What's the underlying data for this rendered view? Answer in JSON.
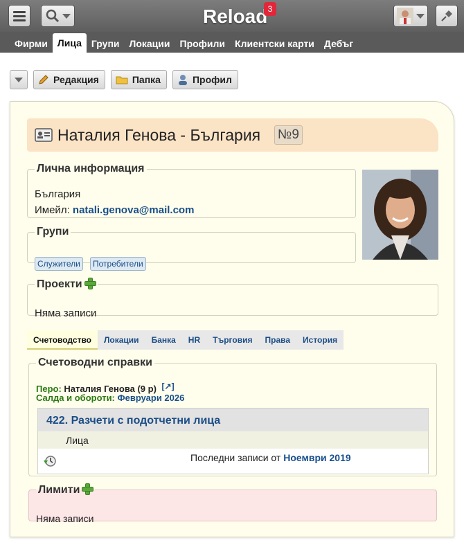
{
  "header": {
    "title": "Reload",
    "badge": "3"
  },
  "nav": {
    "tabs": [
      "Фирми",
      "Лица",
      "Групи",
      "Локации",
      "Профили",
      "Клиентски карти",
      "Дебъг"
    ]
  },
  "toolbar": {
    "edit": "Редакция",
    "folder": "Папка",
    "profile": "Профил"
  },
  "person": {
    "title": "Наталия Генова - България",
    "number": "№9",
    "info_legend": "Лична информация",
    "country": "България",
    "email_label": "Имейл:",
    "email": "natali.genova@mail.com"
  },
  "groups": {
    "legend": "Групи",
    "items": [
      "Служители",
      "Потребители"
    ]
  },
  "projects": {
    "legend": "Проекти",
    "empty": "Няма записи"
  },
  "tabs": [
    "Счетоводство",
    "Локации",
    "Банка",
    "HR",
    "Търговия",
    "Права",
    "История"
  ],
  "accounting": {
    "legend": "Счетоводни справки",
    "pen_label": "Перо:",
    "pen_value": "Наталия Генова (9 р)",
    "ext_link": "[↗]",
    "balances_label": "Салда и обороти:",
    "balances_value": "Февруари 2026",
    "account_title": "422. Разчети с подотчетни лица",
    "sub_label": "Лица",
    "last_prefix": "Последни записи от",
    "last_link": "Ноември 2019"
  },
  "limits": {
    "legend": "Лимити",
    "empty": "Няма записи"
  }
}
